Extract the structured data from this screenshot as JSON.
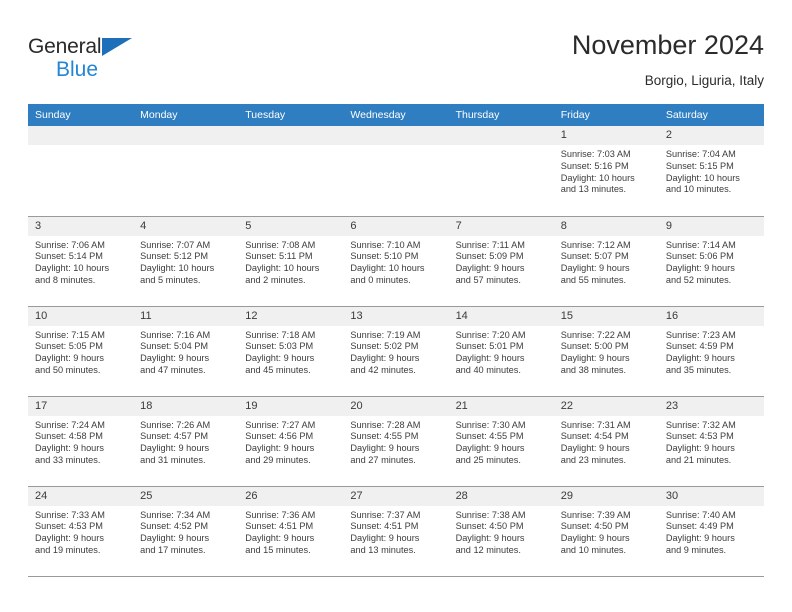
{
  "brand": {
    "name_dark": "General",
    "name_blue": "Blue",
    "accent_color": "#2286d6",
    "triangle_color": "#1e6fba"
  },
  "header": {
    "title": "November 2024",
    "location": "Borgio, Liguria, Italy"
  },
  "theme": {
    "header_row_bg": "#2f7ec1",
    "daynum_band_bg": "#f0f0f0",
    "grid_line": "#9a9a9a",
    "text": "#3c3c3c"
  },
  "weekday_headers": [
    "Sunday",
    "Monday",
    "Tuesday",
    "Wednesday",
    "Thursday",
    "Friday",
    "Saturday"
  ],
  "weeks": [
    [
      {
        "day": "",
        "sunrise": "",
        "sunset": "",
        "daylight1": "",
        "daylight2": "",
        "empty": true
      },
      {
        "day": "",
        "sunrise": "",
        "sunset": "",
        "daylight1": "",
        "daylight2": "",
        "empty": true
      },
      {
        "day": "",
        "sunrise": "",
        "sunset": "",
        "daylight1": "",
        "daylight2": "",
        "empty": true
      },
      {
        "day": "",
        "sunrise": "",
        "sunset": "",
        "daylight1": "",
        "daylight2": "",
        "empty": true
      },
      {
        "day": "",
        "sunrise": "",
        "sunset": "",
        "daylight1": "",
        "daylight2": "",
        "empty": true
      },
      {
        "day": "1",
        "sunrise": "Sunrise: 7:03 AM",
        "sunset": "Sunset: 5:16 PM",
        "daylight1": "Daylight: 10 hours",
        "daylight2": "and 13 minutes.",
        "empty": false
      },
      {
        "day": "2",
        "sunrise": "Sunrise: 7:04 AM",
        "sunset": "Sunset: 5:15 PM",
        "daylight1": "Daylight: 10 hours",
        "daylight2": "and 10 minutes.",
        "empty": false
      }
    ],
    [
      {
        "day": "3",
        "sunrise": "Sunrise: 7:06 AM",
        "sunset": "Sunset: 5:14 PM",
        "daylight1": "Daylight: 10 hours",
        "daylight2": "and 8 minutes.",
        "empty": false
      },
      {
        "day": "4",
        "sunrise": "Sunrise: 7:07 AM",
        "sunset": "Sunset: 5:12 PM",
        "daylight1": "Daylight: 10 hours",
        "daylight2": "and 5 minutes.",
        "empty": false
      },
      {
        "day": "5",
        "sunrise": "Sunrise: 7:08 AM",
        "sunset": "Sunset: 5:11 PM",
        "daylight1": "Daylight: 10 hours",
        "daylight2": "and 2 minutes.",
        "empty": false
      },
      {
        "day": "6",
        "sunrise": "Sunrise: 7:10 AM",
        "sunset": "Sunset: 5:10 PM",
        "daylight1": "Daylight: 10 hours",
        "daylight2": "and 0 minutes.",
        "empty": false
      },
      {
        "day": "7",
        "sunrise": "Sunrise: 7:11 AM",
        "sunset": "Sunset: 5:09 PM",
        "daylight1": "Daylight: 9 hours",
        "daylight2": "and 57 minutes.",
        "empty": false
      },
      {
        "day": "8",
        "sunrise": "Sunrise: 7:12 AM",
        "sunset": "Sunset: 5:07 PM",
        "daylight1": "Daylight: 9 hours",
        "daylight2": "and 55 minutes.",
        "empty": false
      },
      {
        "day": "9",
        "sunrise": "Sunrise: 7:14 AM",
        "sunset": "Sunset: 5:06 PM",
        "daylight1": "Daylight: 9 hours",
        "daylight2": "and 52 minutes.",
        "empty": false
      }
    ],
    [
      {
        "day": "10",
        "sunrise": "Sunrise: 7:15 AM",
        "sunset": "Sunset: 5:05 PM",
        "daylight1": "Daylight: 9 hours",
        "daylight2": "and 50 minutes.",
        "empty": false
      },
      {
        "day": "11",
        "sunrise": "Sunrise: 7:16 AM",
        "sunset": "Sunset: 5:04 PM",
        "daylight1": "Daylight: 9 hours",
        "daylight2": "and 47 minutes.",
        "empty": false
      },
      {
        "day": "12",
        "sunrise": "Sunrise: 7:18 AM",
        "sunset": "Sunset: 5:03 PM",
        "daylight1": "Daylight: 9 hours",
        "daylight2": "and 45 minutes.",
        "empty": false
      },
      {
        "day": "13",
        "sunrise": "Sunrise: 7:19 AM",
        "sunset": "Sunset: 5:02 PM",
        "daylight1": "Daylight: 9 hours",
        "daylight2": "and 42 minutes.",
        "empty": false
      },
      {
        "day": "14",
        "sunrise": "Sunrise: 7:20 AM",
        "sunset": "Sunset: 5:01 PM",
        "daylight1": "Daylight: 9 hours",
        "daylight2": "and 40 minutes.",
        "empty": false
      },
      {
        "day": "15",
        "sunrise": "Sunrise: 7:22 AM",
        "sunset": "Sunset: 5:00 PM",
        "daylight1": "Daylight: 9 hours",
        "daylight2": "and 38 minutes.",
        "empty": false
      },
      {
        "day": "16",
        "sunrise": "Sunrise: 7:23 AM",
        "sunset": "Sunset: 4:59 PM",
        "daylight1": "Daylight: 9 hours",
        "daylight2": "and 35 minutes.",
        "empty": false
      }
    ],
    [
      {
        "day": "17",
        "sunrise": "Sunrise: 7:24 AM",
        "sunset": "Sunset: 4:58 PM",
        "daylight1": "Daylight: 9 hours",
        "daylight2": "and 33 minutes.",
        "empty": false
      },
      {
        "day": "18",
        "sunrise": "Sunrise: 7:26 AM",
        "sunset": "Sunset: 4:57 PM",
        "daylight1": "Daylight: 9 hours",
        "daylight2": "and 31 minutes.",
        "empty": false
      },
      {
        "day": "19",
        "sunrise": "Sunrise: 7:27 AM",
        "sunset": "Sunset: 4:56 PM",
        "daylight1": "Daylight: 9 hours",
        "daylight2": "and 29 minutes.",
        "empty": false
      },
      {
        "day": "20",
        "sunrise": "Sunrise: 7:28 AM",
        "sunset": "Sunset: 4:55 PM",
        "daylight1": "Daylight: 9 hours",
        "daylight2": "and 27 minutes.",
        "empty": false
      },
      {
        "day": "21",
        "sunrise": "Sunrise: 7:30 AM",
        "sunset": "Sunset: 4:55 PM",
        "daylight1": "Daylight: 9 hours",
        "daylight2": "and 25 minutes.",
        "empty": false
      },
      {
        "day": "22",
        "sunrise": "Sunrise: 7:31 AM",
        "sunset": "Sunset: 4:54 PM",
        "daylight1": "Daylight: 9 hours",
        "daylight2": "and 23 minutes.",
        "empty": false
      },
      {
        "day": "23",
        "sunrise": "Sunrise: 7:32 AM",
        "sunset": "Sunset: 4:53 PM",
        "daylight1": "Daylight: 9 hours",
        "daylight2": "and 21 minutes.",
        "empty": false
      }
    ],
    [
      {
        "day": "24",
        "sunrise": "Sunrise: 7:33 AM",
        "sunset": "Sunset: 4:53 PM",
        "daylight1": "Daylight: 9 hours",
        "daylight2": "and 19 minutes.",
        "empty": false
      },
      {
        "day": "25",
        "sunrise": "Sunrise: 7:34 AM",
        "sunset": "Sunset: 4:52 PM",
        "daylight1": "Daylight: 9 hours",
        "daylight2": "and 17 minutes.",
        "empty": false
      },
      {
        "day": "26",
        "sunrise": "Sunrise: 7:36 AM",
        "sunset": "Sunset: 4:51 PM",
        "daylight1": "Daylight: 9 hours",
        "daylight2": "and 15 minutes.",
        "empty": false
      },
      {
        "day": "27",
        "sunrise": "Sunrise: 7:37 AM",
        "sunset": "Sunset: 4:51 PM",
        "daylight1": "Daylight: 9 hours",
        "daylight2": "and 13 minutes.",
        "empty": false
      },
      {
        "day": "28",
        "sunrise": "Sunrise: 7:38 AM",
        "sunset": "Sunset: 4:50 PM",
        "daylight1": "Daylight: 9 hours",
        "daylight2": "and 12 minutes.",
        "empty": false
      },
      {
        "day": "29",
        "sunrise": "Sunrise: 7:39 AM",
        "sunset": "Sunset: 4:50 PM",
        "daylight1": "Daylight: 9 hours",
        "daylight2": "and 10 minutes.",
        "empty": false
      },
      {
        "day": "30",
        "sunrise": "Sunrise: 7:40 AM",
        "sunset": "Sunset: 4:49 PM",
        "daylight1": "Daylight: 9 hours",
        "daylight2": "and 9 minutes.",
        "empty": false
      }
    ]
  ]
}
